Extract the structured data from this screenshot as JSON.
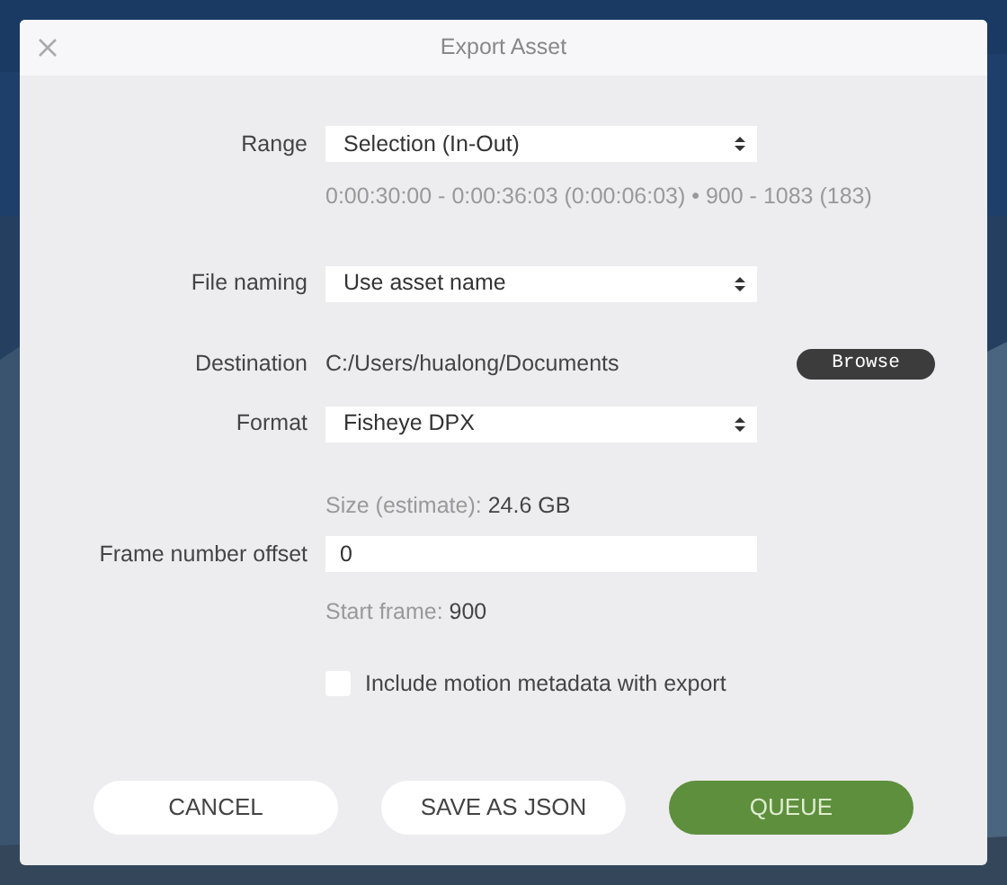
{
  "window": {
    "title": "Export Asset"
  },
  "range": {
    "label": "Range",
    "value": "Selection (In-Out)",
    "info": "0:00:30:00 - 0:00:36:03 (0:00:06:03) • 900 - 1083 (183)"
  },
  "file_naming": {
    "label": "File naming",
    "value": "Use asset name"
  },
  "destination": {
    "label": "Destination",
    "path": "C:/Users/hualong/Documents",
    "button": "Browse"
  },
  "format": {
    "label": "Format",
    "value": "Fisheye DPX"
  },
  "size": {
    "label": "Size (estimate):",
    "value": "24.6 GB"
  },
  "frame_offset": {
    "label": "Frame number offset",
    "value": "0"
  },
  "start_frame": {
    "label": "Start frame:",
    "value": "900"
  },
  "motion_metadata": {
    "label": "Include motion metadata with export",
    "checked": false
  },
  "buttons": [
    {
      "label": "CANCEL",
      "kind": "secondary"
    },
    {
      "label": "SAVE AS JSON",
      "kind": "secondary"
    },
    {
      "label": "QUEUE",
      "kind": "primary"
    }
  ]
}
